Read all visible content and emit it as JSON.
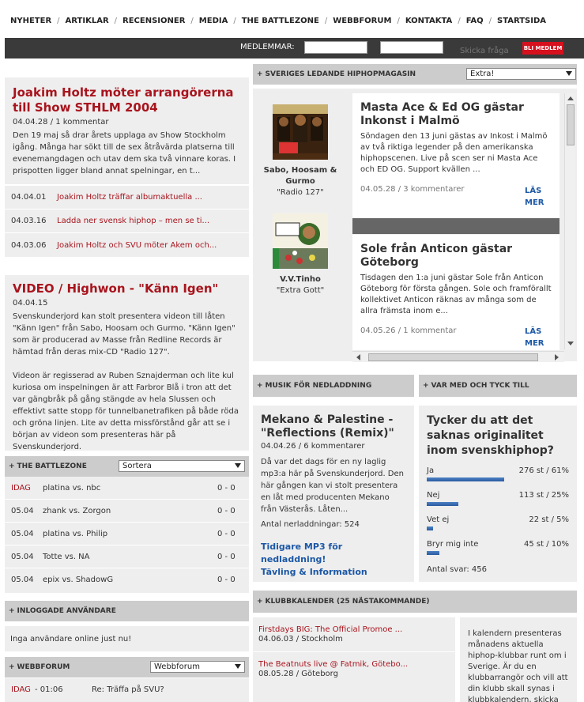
{
  "nav": [
    "NYHETER",
    "ARTIKLAR",
    "RECENSIONER",
    "MEDIA",
    "THE BATTLEZONE",
    "WEBBFORUM",
    "KONTAKTA",
    "FAQ",
    "STARTSIDA"
  ],
  "member": {
    "label": "MEDLEMMAR:",
    "ask": "Skicka fråga",
    "join": "BLI MEDLEM"
  },
  "article1": {
    "title": "Joakim Holtz möter arrangörerna till Show STHLM 2004",
    "meta": "04.04.28 / 1 kommentar",
    "body": "Den 19 maj så drar årets upplaga av Show Stockholm igång. Många har sökt till de sex åtråvärda platserna till evenemangdagen och utav dem ska två vinnare koras. I prispotten ligger bland annat spelningar, en t..."
  },
  "article_list": [
    {
      "date": "04.04.01",
      "title": "Joakim Holtz träffar albumaktuella ..."
    },
    {
      "date": "04.03.16",
      "title": "Ladda ner svensk hiphop – men se ti..."
    },
    {
      "date": "04.03.06",
      "title": "Joakim Holtz och SVU möter Akem och..."
    }
  ],
  "article2": {
    "title": "VIDEO / Highwon - \"Känn Igen\"",
    "meta": "04.04.15",
    "body1": "Svenskunderjord kan stolt presentera videon till låten \"Känn Igen\" från Sabo, Hoosam och Gurmo. \"Känn Igen\" som är producerad av Masse från Redline Records är hämtad från deras mix-CD \"Radio 127\".",
    "body2": "Videon är regisserad av Ruben Sznajderman och lite kul kuriosa om inspelningen är att Farbror Blå i tron att det var gängbråk på gång stängde av hela Slussen och effektivt satte stopp för tunnelbanetrafiken på både röda och gröna linjen. Lite av detta missförstånd går att se i början av videon som presenteras här på Svenskunderjord."
  },
  "battlezone": {
    "title": "THE BATTLEZONE",
    "sort": "Sortera",
    "rows": [
      {
        "date": "IDAG",
        "match": "platina vs. nbc",
        "score": "0 - 0"
      },
      {
        "date": "05.04",
        "match": "zhank vs. Zorgon",
        "score": "0 - 0"
      },
      {
        "date": "05.04",
        "match": "platina vs. Philip",
        "score": "0 - 0"
      },
      {
        "date": "05.04",
        "match": "Totte vs. NA",
        "score": "0 - 0"
      },
      {
        "date": "05.04",
        "match": "epix vs. ShadowG",
        "score": "0 - 0"
      }
    ]
  },
  "online": {
    "title": "INLOGGADE ANVÄNDARE",
    "text": "Inga användare online just nu!"
  },
  "forum": {
    "title": "WEBBFORUM",
    "select": "Webbforum",
    "row": {
      "date": "IDAG",
      "time": "- 01:06",
      "topic": "Re: Träffa på SVU?"
    }
  },
  "magazine": {
    "title": "SVERIGES LEDANDE HIPHOPMAGASIN",
    "select": "Extra!",
    "albums": [
      {
        "name": "Sabo, Hoosam & Gurmo",
        "album": "\"Radio 127\""
      },
      {
        "name": "V.V.Tinho",
        "album": "\"Extra Gott\""
      }
    ],
    "cards": [
      {
        "title": "Masta Ace & Ed OG gästar Inkonst i Malmö",
        "body": "Söndagen den 13 juni gästas av Inkost i Malmö av två riktiga legender på den amerikanska hiphopscenen. Live på scen ser ni Masta Ace och ED OG. Support kvällen ...",
        "meta": "04.05.28 / 3 kommentarer",
        "more": "LÄS MER"
      },
      {
        "title": "Sole från Anticon gästar Göteborg",
        "body": "Tisdagen den 1:a juni gästar Sole från Anticon Göteborg för första gången. Sole och framförallt kollektivet Anticon räknas av många som de allra främsta inom e...",
        "meta": "04.05.26 / 1 kommentar",
        "more": "LÄS MER"
      }
    ]
  },
  "mp3": {
    "head": "MUSIK FÖR NEDLADDNING",
    "title": "Mekano & Palestine - \"Reflections (Remix)\"",
    "meta": "04.04.26 / 6 kommentarer",
    "body": "Då var det dags för en ny laglig mp3:a här på Svenskunderjord. Den här gången kan vi stolt presentera en låt med producenten Mekano från Västerås. Låten...",
    "count": "Antal nerladdningar: 524",
    "link1": "Tidigare MP3 för nedladdning!",
    "link2": "Tävling & Information"
  },
  "poll": {
    "head": "VAR MED OCH TYCK TILL",
    "question": "Tycker du att det saknas originalitet inom svenskhiphop?",
    "options": [
      {
        "label": "Ja",
        "value": "276 st / 61%",
        "pct": 61
      },
      {
        "label": "Nej",
        "value": "113 st / 25%",
        "pct": 25
      },
      {
        "label": "Vet ej",
        "value": "22 st / 5%",
        "pct": 5
      },
      {
        "label": "Bryr mig inte",
        "value": "45 st / 10%",
        "pct": 10
      }
    ],
    "total": "Antal svar: 456"
  },
  "club": {
    "head": "KLUBBKALENDER (25 NÄSTAKOMMANDE)",
    "items": [
      {
        "title": "Firstdays BIG: The Official Promoe ...",
        "meta": "04.06.03 / Stockholm"
      },
      {
        "title": "The Beatnuts live @ Fatmik, Götebo...",
        "meta": "08.05.28 / Göteborg"
      }
    ],
    "info": "I kalendern presenteras månadens aktuella hiphop-klubbar runt om i Sverige. Är du en klubbarrangör och vill att din klubb skall synas i klubbkalendern, skicka ett"
  },
  "colors": {
    "accent_red": "#a8141d",
    "link_blue": "#1c58a6",
    "panel": "#eeeeee",
    "header": "#cccccc"
  }
}
